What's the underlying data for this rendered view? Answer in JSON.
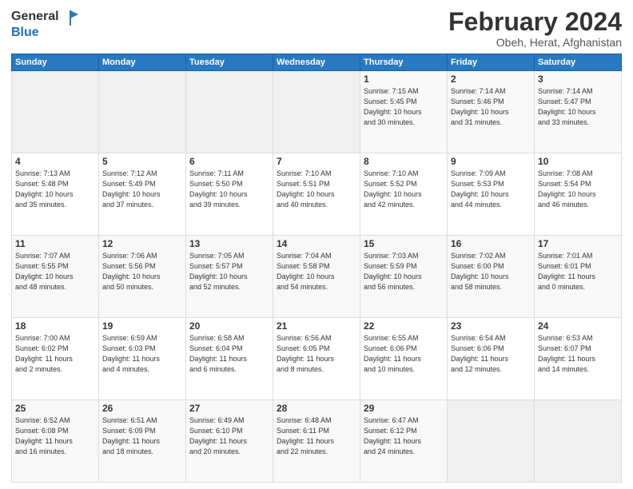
{
  "header": {
    "logo_general": "General",
    "logo_blue": "Blue",
    "month_title": "February 2024",
    "location": "Obeh, Herat, Afghanistan"
  },
  "days_of_week": [
    "Sunday",
    "Monday",
    "Tuesday",
    "Wednesday",
    "Thursday",
    "Friday",
    "Saturday"
  ],
  "weeks": [
    [
      {
        "day": "",
        "detail": ""
      },
      {
        "day": "",
        "detail": ""
      },
      {
        "day": "",
        "detail": ""
      },
      {
        "day": "",
        "detail": ""
      },
      {
        "day": "1",
        "detail": "Sunrise: 7:15 AM\nSunset: 5:45 PM\nDaylight: 10 hours\nand 30 minutes."
      },
      {
        "day": "2",
        "detail": "Sunrise: 7:14 AM\nSunset: 5:46 PM\nDaylight: 10 hours\nand 31 minutes."
      },
      {
        "day": "3",
        "detail": "Sunrise: 7:14 AM\nSunset: 5:47 PM\nDaylight: 10 hours\nand 33 minutes."
      }
    ],
    [
      {
        "day": "4",
        "detail": "Sunrise: 7:13 AM\nSunset: 5:48 PM\nDaylight: 10 hours\nand 35 minutes."
      },
      {
        "day": "5",
        "detail": "Sunrise: 7:12 AM\nSunset: 5:49 PM\nDaylight: 10 hours\nand 37 minutes."
      },
      {
        "day": "6",
        "detail": "Sunrise: 7:11 AM\nSunset: 5:50 PM\nDaylight: 10 hours\nand 39 minutes."
      },
      {
        "day": "7",
        "detail": "Sunrise: 7:10 AM\nSunset: 5:51 PM\nDaylight: 10 hours\nand 40 minutes."
      },
      {
        "day": "8",
        "detail": "Sunrise: 7:10 AM\nSunset: 5:52 PM\nDaylight: 10 hours\nand 42 minutes."
      },
      {
        "day": "9",
        "detail": "Sunrise: 7:09 AM\nSunset: 5:53 PM\nDaylight: 10 hours\nand 44 minutes."
      },
      {
        "day": "10",
        "detail": "Sunrise: 7:08 AM\nSunset: 5:54 PM\nDaylight: 10 hours\nand 46 minutes."
      }
    ],
    [
      {
        "day": "11",
        "detail": "Sunrise: 7:07 AM\nSunset: 5:55 PM\nDaylight: 10 hours\nand 48 minutes."
      },
      {
        "day": "12",
        "detail": "Sunrise: 7:06 AM\nSunset: 5:56 PM\nDaylight: 10 hours\nand 50 minutes."
      },
      {
        "day": "13",
        "detail": "Sunrise: 7:05 AM\nSunset: 5:57 PM\nDaylight: 10 hours\nand 52 minutes."
      },
      {
        "day": "14",
        "detail": "Sunrise: 7:04 AM\nSunset: 5:58 PM\nDaylight: 10 hours\nand 54 minutes."
      },
      {
        "day": "15",
        "detail": "Sunrise: 7:03 AM\nSunset: 5:59 PM\nDaylight: 10 hours\nand 56 minutes."
      },
      {
        "day": "16",
        "detail": "Sunrise: 7:02 AM\nSunset: 6:00 PM\nDaylight: 10 hours\nand 58 minutes."
      },
      {
        "day": "17",
        "detail": "Sunrise: 7:01 AM\nSunset: 6:01 PM\nDaylight: 11 hours\nand 0 minutes."
      }
    ],
    [
      {
        "day": "18",
        "detail": "Sunrise: 7:00 AM\nSunset: 6:02 PM\nDaylight: 11 hours\nand 2 minutes."
      },
      {
        "day": "19",
        "detail": "Sunrise: 6:59 AM\nSunset: 6:03 PM\nDaylight: 11 hours\nand 4 minutes."
      },
      {
        "day": "20",
        "detail": "Sunrise: 6:58 AM\nSunset: 6:04 PM\nDaylight: 11 hours\nand 6 minutes."
      },
      {
        "day": "21",
        "detail": "Sunrise: 6:56 AM\nSunset: 6:05 PM\nDaylight: 11 hours\nand 8 minutes."
      },
      {
        "day": "22",
        "detail": "Sunrise: 6:55 AM\nSunset: 6:06 PM\nDaylight: 11 hours\nand 10 minutes."
      },
      {
        "day": "23",
        "detail": "Sunrise: 6:54 AM\nSunset: 6:06 PM\nDaylight: 11 hours\nand 12 minutes."
      },
      {
        "day": "24",
        "detail": "Sunrise: 6:53 AM\nSunset: 6:07 PM\nDaylight: 11 hours\nand 14 minutes."
      }
    ],
    [
      {
        "day": "25",
        "detail": "Sunrise: 6:52 AM\nSunset: 6:08 PM\nDaylight: 11 hours\nand 16 minutes."
      },
      {
        "day": "26",
        "detail": "Sunrise: 6:51 AM\nSunset: 6:09 PM\nDaylight: 11 hours\nand 18 minutes."
      },
      {
        "day": "27",
        "detail": "Sunrise: 6:49 AM\nSunset: 6:10 PM\nDaylight: 11 hours\nand 20 minutes."
      },
      {
        "day": "28",
        "detail": "Sunrise: 6:48 AM\nSunset: 6:11 PM\nDaylight: 11 hours\nand 22 minutes."
      },
      {
        "day": "29",
        "detail": "Sunrise: 6:47 AM\nSunset: 6:12 PM\nDaylight: 11 hours\nand 24 minutes."
      },
      {
        "day": "",
        "detail": ""
      },
      {
        "day": "",
        "detail": ""
      }
    ]
  ]
}
